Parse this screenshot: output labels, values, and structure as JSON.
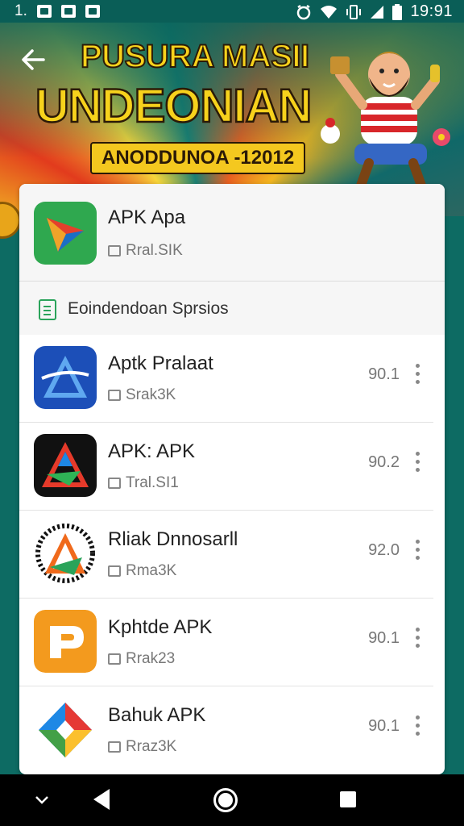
{
  "status_bar": {
    "left_text": "1.",
    "time": "19:91",
    "icons": [
      "image-icon",
      "shield-icon",
      "mail-icon",
      "alarm-icon",
      "wifi-icon",
      "vibrate-icon",
      "signal-icon",
      "battery-icon"
    ]
  },
  "banner": {
    "title_line1": "PUSURA MASII",
    "title_line2": "UNDEONIAN",
    "subtitle": "ANODDUNOA -12012",
    "colors": {
      "title": "#f7d21c",
      "outline": "#2b1a07"
    }
  },
  "top_app": {
    "name": "APK Apa",
    "meta": "Rral.SIK"
  },
  "section": {
    "title": "Eoindendoan Sprsios"
  },
  "apps": [
    {
      "name": "Aptk Pralaat",
      "meta": "Srak3K",
      "value": "90.1",
      "icon": "blue-triangle-icon"
    },
    {
      "name": "APK: APK",
      "meta": "Tral.SI1",
      "value": "90.2",
      "icon": "black-multicolor-a-icon"
    },
    {
      "name": "Rliak Dnnosarll",
      "meta": "Rma3K",
      "value": "92.0",
      "icon": "sunburst-a-icon"
    },
    {
      "name": "Kphtde APK",
      "meta": "Rrak23",
      "value": "90.1",
      "icon": "orange-p-icon"
    },
    {
      "name": "Bahuk APK",
      "meta": "Rraz3K",
      "value": "90.1",
      "icon": "colorful-diamond-icon"
    }
  ],
  "colors": {
    "status_bar": "#0a5e57",
    "section_icon": "#2aa35a",
    "nav_bar": "#000000"
  }
}
